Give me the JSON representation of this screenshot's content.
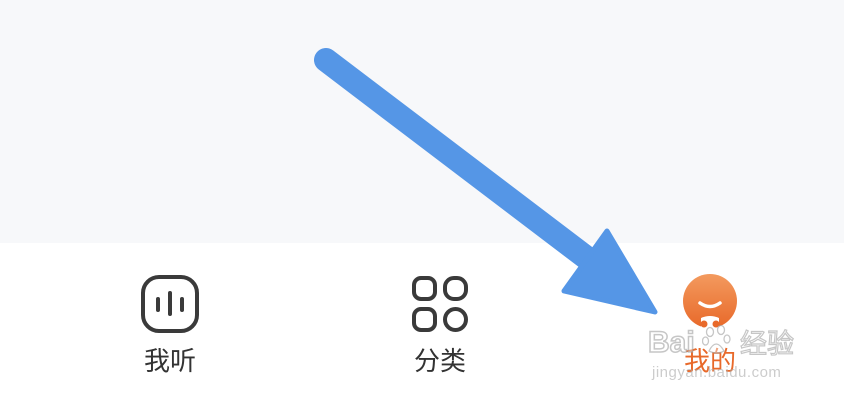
{
  "tabs": [
    {
      "label": "我听",
      "icon": "listen-icon",
      "active": false
    },
    {
      "label": "分类",
      "icon": "category-icon",
      "active": false
    },
    {
      "label": "我的",
      "icon": "mine-avatar-icon",
      "active": true
    }
  ],
  "colors": {
    "background": "#f7f8fa",
    "tabbar": "#ffffff",
    "text": "#333333",
    "icon_stroke": "#3a3a3a",
    "active": "#e8692a",
    "annotation_arrow": "#5596e6"
  },
  "watermark": {
    "brand": "Bai",
    "product": "经验",
    "url": "jingyan.baidu.com"
  }
}
